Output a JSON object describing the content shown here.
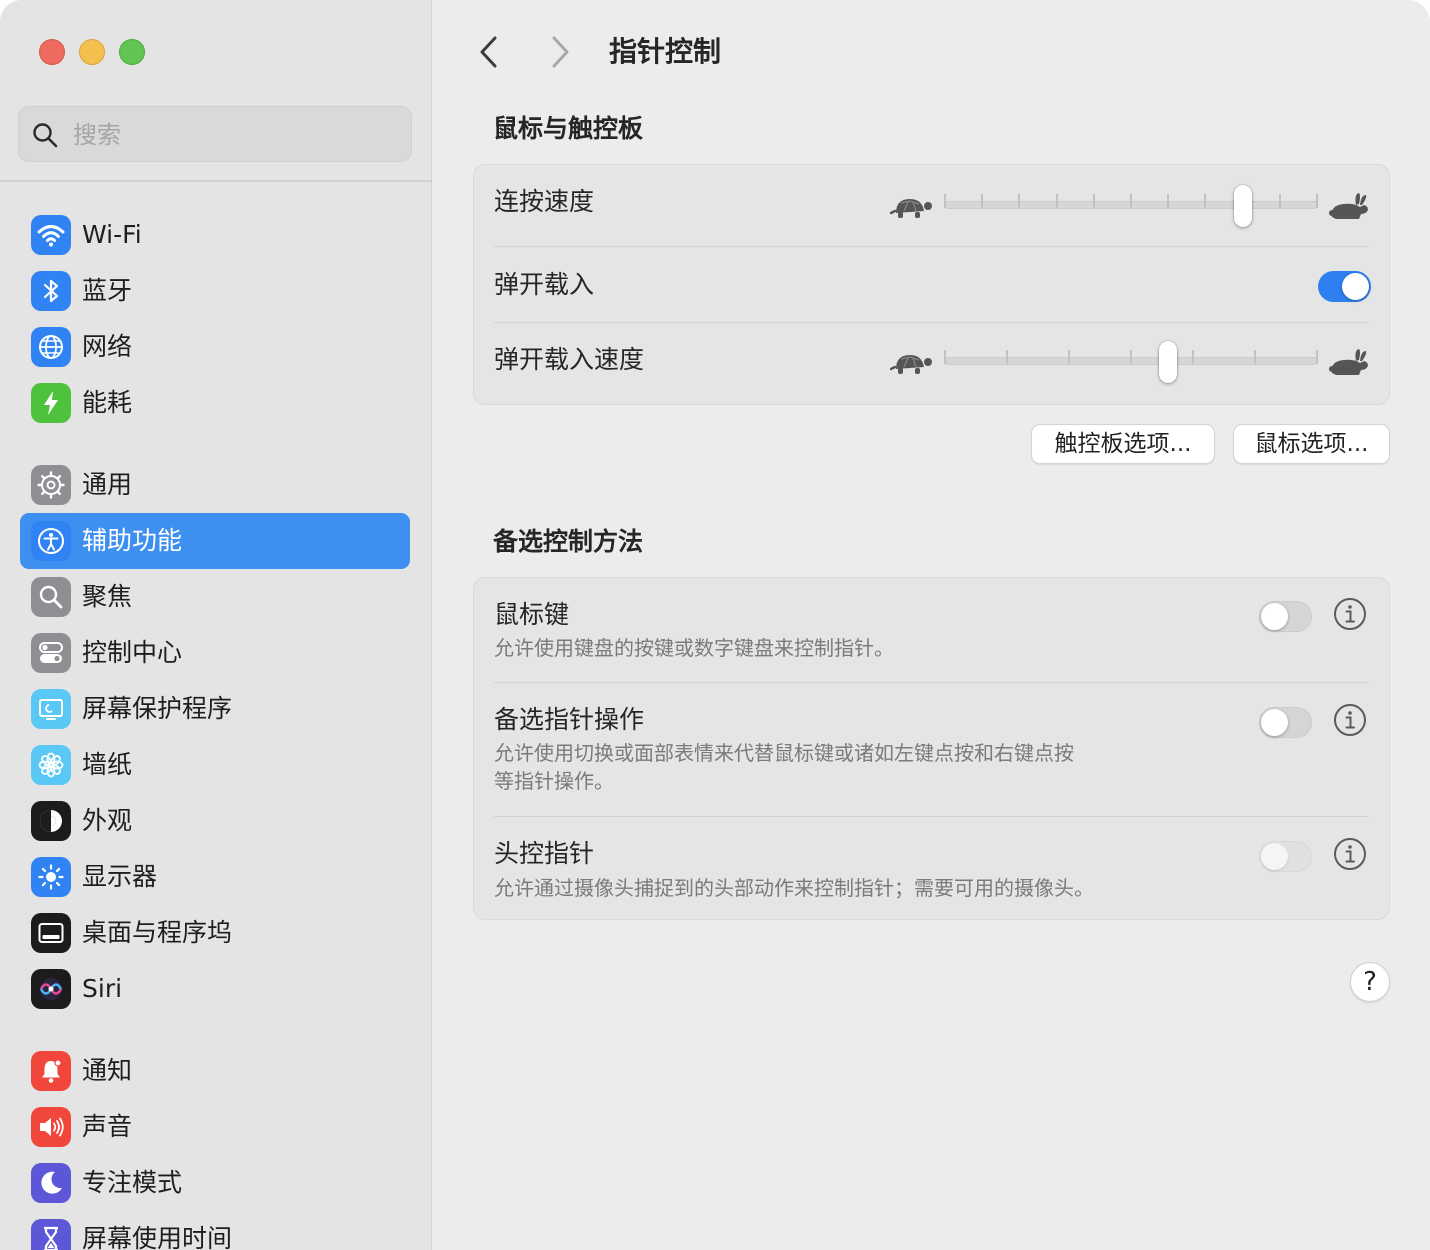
{
  "window": {
    "controls": [
      "close",
      "minimize",
      "zoom"
    ]
  },
  "search": {
    "placeholder": "搜索",
    "value": ""
  },
  "sidebar": {
    "items": [
      {
        "label": "Wi-Fi",
        "icon": "wifi-icon",
        "color": "#2f83f3"
      },
      {
        "label": "蓝牙",
        "icon": "bluetooth-icon",
        "color": "#2f83f3"
      },
      {
        "label": "网络",
        "icon": "globe-icon",
        "color": "#2f83f3"
      },
      {
        "label": "能耗",
        "icon": "battery-bolt-icon",
        "color": "#4fc23d"
      },
      {
        "label": "通用",
        "icon": "gear-icon",
        "color": "#8e8e93"
      },
      {
        "label": "辅助功能",
        "icon": "accessibility-icon",
        "color": "#2f83f3",
        "active": true
      },
      {
        "label": "聚焦",
        "icon": "magnifier-icon",
        "color": "#8e8e93"
      },
      {
        "label": "控制中心",
        "icon": "switches-icon",
        "color": "#8e8e93"
      },
      {
        "label": "屏幕保护程序",
        "icon": "screensaver-icon",
        "color": "#5ac8f5"
      },
      {
        "label": "墙纸",
        "icon": "flower-icon",
        "color": "#5ac8f5"
      },
      {
        "label": "外观",
        "icon": "appearance-icon",
        "color": "#1c1c1e"
      },
      {
        "label": "显示器",
        "icon": "sun-icon",
        "color": "#2f83f3"
      },
      {
        "label": "桌面与程序坞",
        "icon": "dock-icon",
        "color": "#1c1c1e"
      },
      {
        "label": "Siri",
        "icon": "siri-icon",
        "color": "#1c1c1e"
      },
      {
        "label": "通知",
        "icon": "bell-icon",
        "color": "#f0463c"
      },
      {
        "label": "声音",
        "icon": "speaker-icon",
        "color": "#f0463c"
      },
      {
        "label": "专注模式",
        "icon": "moon-icon",
        "color": "#5b57d6"
      },
      {
        "label": "屏幕使用时间",
        "icon": "hourglass-icon",
        "color": "#5b57d6"
      }
    ]
  },
  "header": {
    "title": "指针控制"
  },
  "mouse_trackpad": {
    "section_title": "鼠标与触控板",
    "double_click_speed": {
      "label": "连按速度",
      "value_fraction": 0.8,
      "ticks": 11
    },
    "spring_loading": {
      "label": "弹开载入",
      "on": true
    },
    "spring_loading_speed": {
      "label": "弹开载入速度",
      "value_fraction": 0.6,
      "ticks": 7
    },
    "trackpad_options_label": "触控板选项...",
    "mouse_options_label": "鼠标选项..."
  },
  "alternate_control": {
    "section_title": "备选控制方法",
    "mouse_keys": {
      "label": "鼠标键",
      "description": "允许使用键盘的按键或数字键盘来控制指针。",
      "on": false
    },
    "alternate_pointer_actions": {
      "label": "备选指针操作",
      "description_line1": "允许使用切换或面部表情来代替鼠标键或诸如左键点按和右键点按",
      "description_line2": "等指针操作。",
      "on": false
    },
    "head_pointer": {
      "label": "头控指针",
      "description": "允许通过摄像头捕捉到的头部动作来控制指针；需要可用的摄像头。",
      "on": false,
      "disabled": true
    }
  },
  "help": {
    "label": "?"
  },
  "colors": {
    "accent": "#2f7ff0",
    "sidebar_selection": "#3d8ff0"
  }
}
